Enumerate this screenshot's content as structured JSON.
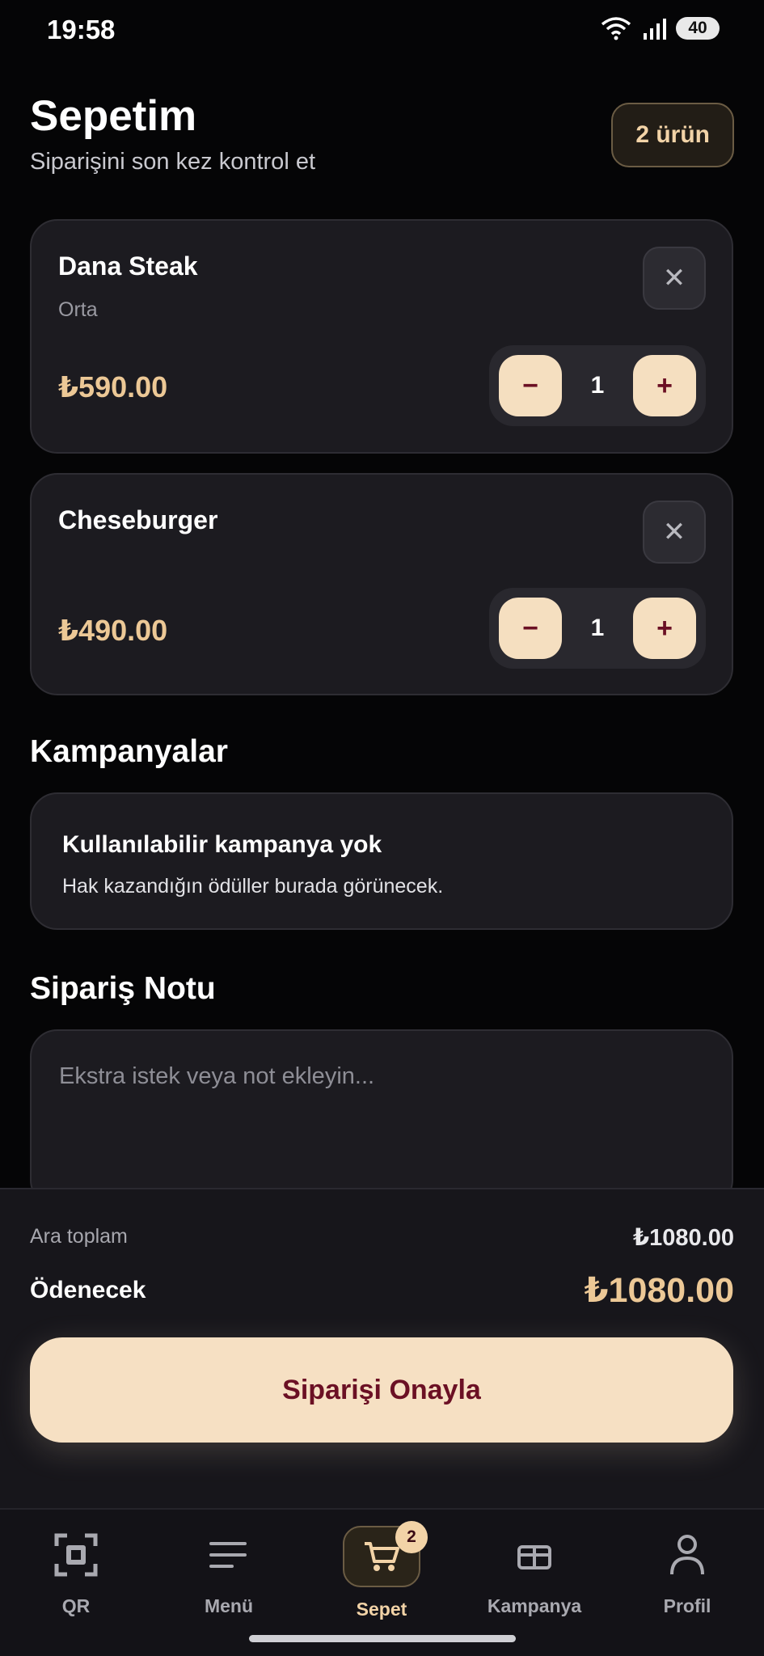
{
  "status_bar": {
    "time": "19:58",
    "battery": "40"
  },
  "header": {
    "title": "Sepetim",
    "subtitle": "Siparişini son kez kontrol et",
    "item_count": "2 ürün"
  },
  "cart_items": [
    {
      "name": "Dana Steak",
      "variant": "Orta",
      "price": "₺590.00",
      "quantity": "1"
    },
    {
      "name": "Cheseburger",
      "variant": "",
      "price": "₺490.00",
      "quantity": "1"
    }
  ],
  "stepper": {
    "minus": "−",
    "plus": "+"
  },
  "campaigns": {
    "title": "Kampanyalar",
    "empty_title": "Kullanılabilir kampanya yok",
    "empty_desc": "Hak kazandığın ödüller burada görünecek."
  },
  "order_note": {
    "title": "Sipariş Notu",
    "placeholder": "Ekstra istek veya not ekleyin..."
  },
  "summary": {
    "subtotal_label": "Ara toplam",
    "subtotal_value": "₺1080.00",
    "total_label": "Ödenecek",
    "total_value": "₺1080.00",
    "confirm_label": "Siparişi Onayla"
  },
  "tab_bar": {
    "tabs": [
      {
        "label": "QR",
        "icon": "qr-scan-icon"
      },
      {
        "label": "Menü",
        "icon": "menu-lines-icon"
      },
      {
        "label": "Sepet",
        "icon": "cart-icon",
        "active": true,
        "badge": "2"
      },
      {
        "label": "Kampanya",
        "icon": "gift-icon"
      },
      {
        "label": "Profil",
        "icon": "user-icon"
      }
    ]
  },
  "colors": {
    "accent": "#ECC896",
    "button_bg": "#F6E0C3",
    "button_text": "#6B1024",
    "card_bg": "#1C1B20"
  }
}
